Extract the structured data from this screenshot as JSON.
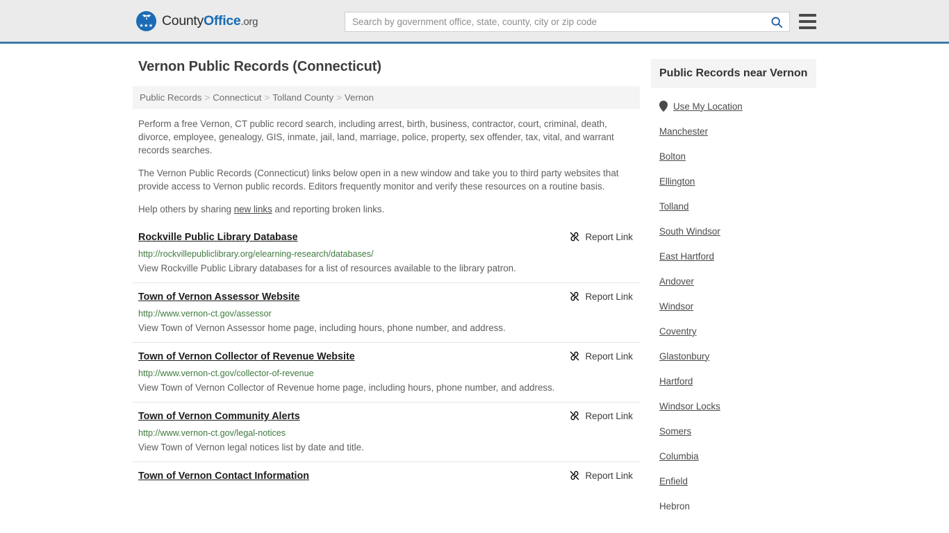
{
  "header": {
    "brand": {
      "part1": "County",
      "part2": "Office",
      "part3": ".org",
      "icon": "eagle-seal-logo",
      "stars": "★★★"
    },
    "search": {
      "placeholder": "Search by government office, state, county, city or zip code",
      "value": "",
      "search_icon": "search-icon"
    },
    "menu_icon": "hamburger-menu-icon",
    "background": "#ebebeb",
    "accent_border": "#3c78a8"
  },
  "main": {
    "title": "Vernon Public Records (Connecticut)",
    "breadcrumb": {
      "separator": ">",
      "items": [
        {
          "label": "Public Records"
        },
        {
          "label": "Connecticut"
        },
        {
          "label": "Tolland County"
        },
        {
          "label": "Vernon"
        }
      ]
    },
    "paragraphs": [
      "Perform a free Vernon, CT public record search, including arrest, birth, business, contractor, court, criminal, death, divorce, employee, genealogy, GIS, inmate, jail, land, marriage, police, property, sex offender, tax, vital, and warrant records searches.",
      "The Vernon Public Records (Connecticut) links below open in a new window and take you to third party websites that provide access to Vernon public records. Editors frequently monitor and verify these resources on a routine basis."
    ],
    "help_line": {
      "before": "Help others by sharing ",
      "link": "new links",
      "after": " and reporting broken links."
    },
    "report_label": "Report Link",
    "report_icon": "broken-link-icon",
    "url_color": "#3f7a3f",
    "links": [
      {
        "title": "Rockville Public Library Database",
        "url": "http://rockvillepubliclibrary.org/elearning-research/databases/",
        "description": "View Rockville Public Library databases for a list of resources available to the library patron."
      },
      {
        "title": "Town of Vernon Assessor Website",
        "url": "http://www.vernon-ct.gov/assessor",
        "description": "View Town of Vernon Assessor home page, including hours, phone number, and address."
      },
      {
        "title": "Town of Vernon Collector of Revenue Website",
        "url": "http://www.vernon-ct.gov/collector-of-revenue",
        "description": "View Town of Vernon Collector of Revenue home page, including hours, phone number, and address."
      },
      {
        "title": "Town of Vernon Community Alerts",
        "url": "http://www.vernon-ct.gov/legal-notices",
        "description": "View Town of Vernon legal notices list by date and title."
      },
      {
        "title": "Town of Vernon Contact Information",
        "url": "",
        "description": ""
      }
    ]
  },
  "sidebar": {
    "title": "Public Records near Vernon",
    "use_my_location": {
      "label": "Use My Location",
      "icon": "map-pin-icon"
    },
    "places": [
      {
        "label": "Manchester"
      },
      {
        "label": "Bolton"
      },
      {
        "label": "Ellington"
      },
      {
        "label": "Tolland"
      },
      {
        "label": "South Windsor"
      },
      {
        "label": "East Hartford"
      },
      {
        "label": "Andover"
      },
      {
        "label": "Windsor"
      },
      {
        "label": "Coventry"
      },
      {
        "label": "Glastonbury"
      },
      {
        "label": "Hartford"
      },
      {
        "label": "Windsor Locks"
      },
      {
        "label": "Somers"
      },
      {
        "label": "Columbia"
      },
      {
        "label": "Enfield"
      },
      {
        "label": "Hebron"
      }
    ]
  }
}
